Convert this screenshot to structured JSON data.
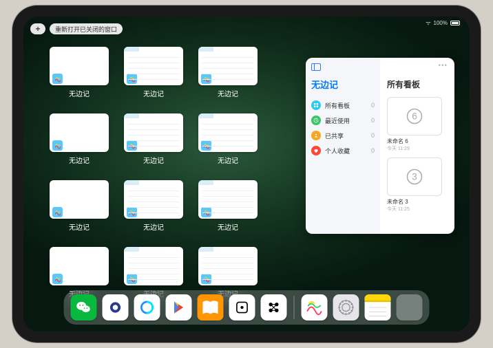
{
  "status": {
    "battery": "100%",
    "signal": "••••"
  },
  "top": {
    "reopen_label": "重新打开已关闭的窗口"
  },
  "overview": {
    "app_name": "无边记",
    "items": [
      {
        "label": "无边记",
        "detailed": false
      },
      {
        "label": "无边记",
        "detailed": true
      },
      {
        "label": "无边记",
        "detailed": true
      },
      {
        "label": "无边记",
        "detailed": false
      },
      {
        "label": "无边记",
        "detailed": true
      },
      {
        "label": "无边记",
        "detailed": true
      },
      {
        "label": "无边记",
        "detailed": false
      },
      {
        "label": "无边记",
        "detailed": true
      },
      {
        "label": "无边记",
        "detailed": true
      },
      {
        "label": "无边记",
        "detailed": false
      },
      {
        "label": "无边记",
        "detailed": true
      },
      {
        "label": "无边记",
        "detailed": true
      }
    ]
  },
  "panel": {
    "left_title": "无边记",
    "right_title": "所有看板",
    "categories": [
      {
        "icon": "grid",
        "color": "#2fcbef",
        "label": "所有看板",
        "count": 0
      },
      {
        "icon": "clock",
        "color": "#3ac569",
        "label": "最近使用",
        "count": 0
      },
      {
        "icon": "share",
        "color": "#f5a623",
        "label": "已共享",
        "count": 0
      },
      {
        "icon": "heart",
        "color": "#ff453a",
        "label": "个人收藏",
        "count": 0
      }
    ],
    "boards": [
      {
        "name": "未命名 6",
        "sub": "今天 11:29",
        "digit": "6"
      },
      {
        "name": "未命名 3",
        "sub": "今天 11:25",
        "digit": "3"
      }
    ]
  },
  "dock": {
    "apps": [
      {
        "name": "wechat",
        "bg": "#09b83e"
      },
      {
        "name": "quark",
        "bg": "#ffffff"
      },
      {
        "name": "qqbrowser",
        "bg": "#ffffff"
      },
      {
        "name": "play",
        "bg": "#ffffff"
      },
      {
        "name": "books",
        "bg": "#ff9500"
      },
      {
        "name": "dice",
        "bg": "#ffffff"
      },
      {
        "name": "obsidian",
        "bg": "#ffffff"
      }
    ],
    "recent": [
      {
        "name": "freeform",
        "bg": "#ffffff"
      },
      {
        "name": "settings",
        "bg": "#e5e5ea"
      },
      {
        "name": "notes",
        "bg": "#ffffff"
      },
      {
        "name": "app-library",
        "bg": "split"
      }
    ]
  },
  "colors": {
    "accent": "#007aff"
  }
}
